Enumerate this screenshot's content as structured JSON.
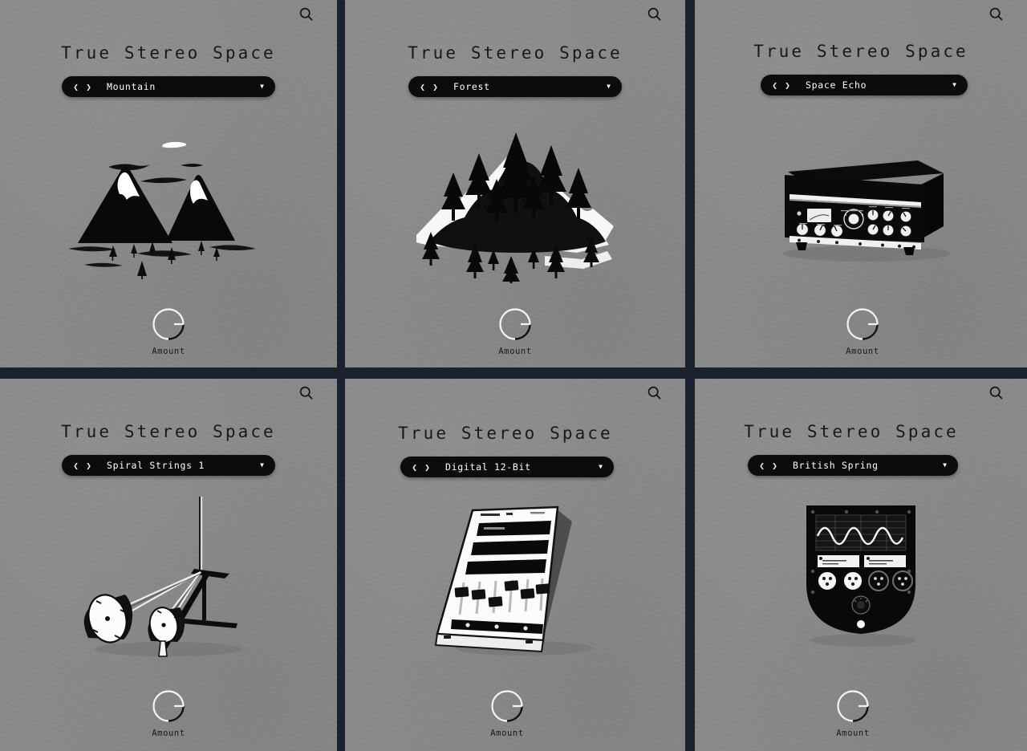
{
  "app": {
    "plugin_title": "True Stereo Space",
    "knob_label": "Amount",
    "search_icon": "search-icon",
    "prev_icon": "chevron-left-icon",
    "next_icon": "chevron-right-icon",
    "dropdown_icon": "caret-down-icon",
    "colors": {
      "panel_background": "#8a8a8a",
      "divider": "#1b212e",
      "preset_bar": "#0c0c0c",
      "preset_text": "#ffffff",
      "title_text": "#17181a",
      "artwork_ink": "#0a0a0a",
      "artwork_highlight": "#ffffff"
    }
  },
  "panels": [
    {
      "id": "panel-1",
      "title": "True Stereo Space",
      "preset": "Mountain",
      "artwork": "mountain-illustration",
      "knob_label": "Amount",
      "knob_value_pct": 72
    },
    {
      "id": "panel-2",
      "title": "True Stereo Space",
      "preset": "Forest",
      "artwork": "forest-illustration",
      "knob_label": "Amount",
      "knob_value_pct": 72
    },
    {
      "id": "panel-3",
      "title": "True Stereo Space",
      "preset": "Space Echo",
      "artwork": "tape-echo-unit-illustration",
      "knob_label": "Amount",
      "knob_value_pct": 72
    },
    {
      "id": "panel-4",
      "title": "True Stereo Space",
      "preset": "Spiral Strings 1",
      "artwork": "spring-reverb-tank-illustration",
      "knob_label": "Amount",
      "knob_value_pct": 72
    },
    {
      "id": "panel-5",
      "title": "True Stereo Space",
      "preset": "Digital 12-Bit",
      "artwork": "digital-rack-unit-illustration",
      "knob_label": "Amount",
      "knob_value_pct": 72
    },
    {
      "id": "panel-6",
      "title": "True Stereo Space",
      "preset": "British Spring",
      "artwork": "british-spring-amp-illustration",
      "knob_label": "Amount",
      "knob_value_pct": 72
    }
  ]
}
